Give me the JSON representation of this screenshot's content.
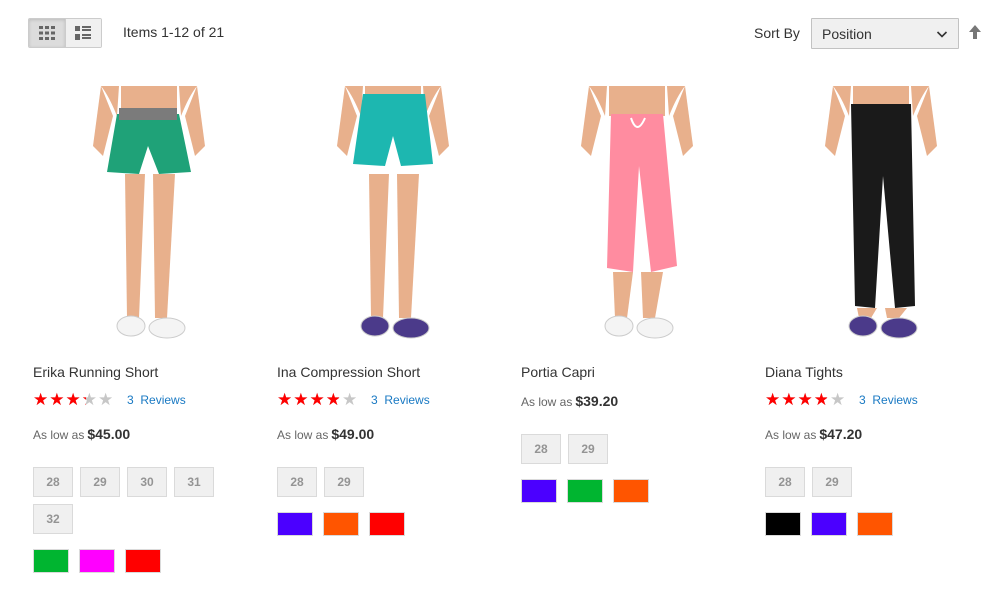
{
  "toolbar": {
    "view_modes": [
      {
        "name": "Grid",
        "icon": "grid-icon",
        "active": true
      },
      {
        "name": "List",
        "icon": "list-icon",
        "active": false
      }
    ],
    "amount": "Items 1-12 of 21",
    "sort_label": "Sort By",
    "sort_value": "Position",
    "sort_direction_icon": "arrow-up-icon"
  },
  "products": [
    {
      "name": "Erika Running Short",
      "rating": 3,
      "reviews_count": "3",
      "reviews_label": "Reviews",
      "has_reviews": true,
      "price_prefix": "As low as",
      "price": "$45.00",
      "sizes": [
        "28",
        "29",
        "30",
        "31",
        "32"
      ],
      "colors": [
        "#00b530",
        "#ff00ff",
        "#ff0000"
      ],
      "garment_color": "#1fa278",
      "waist_color": "#7b7b7b"
    },
    {
      "name": "Ina Compression Short",
      "rating": 3.5,
      "reviews_count": "3",
      "reviews_label": "Reviews",
      "has_reviews": true,
      "price_prefix": "As low as",
      "price": "$49.00",
      "sizes": [
        "28",
        "29"
      ],
      "colors": [
        "#4b00ff",
        "#ff5500",
        "#ff0000"
      ],
      "garment_color": "#1db7b0",
      "waist_color": "#1db7b0"
    },
    {
      "name": "Portia Capri",
      "rating": 0,
      "has_reviews": false,
      "price_prefix": "As low as",
      "price": "$39.20",
      "sizes": [
        "28",
        "29"
      ],
      "colors": [
        "#4b00ff",
        "#00b530",
        "#ff5500"
      ],
      "garment_color": "#ff8ca0",
      "waist_color": "#ff8ca0"
    },
    {
      "name": "Diana Tights",
      "rating": 3.5,
      "reviews_count": "3",
      "reviews_label": "Reviews",
      "has_reviews": true,
      "price_prefix": "As low as",
      "price": "$47.20",
      "sizes": [
        "28",
        "29"
      ],
      "colors": [
        "#000000",
        "#4b00ff",
        "#ff5500"
      ],
      "garment_color": "#1a1a1a",
      "waist_color": "#1a1a1a"
    }
  ]
}
